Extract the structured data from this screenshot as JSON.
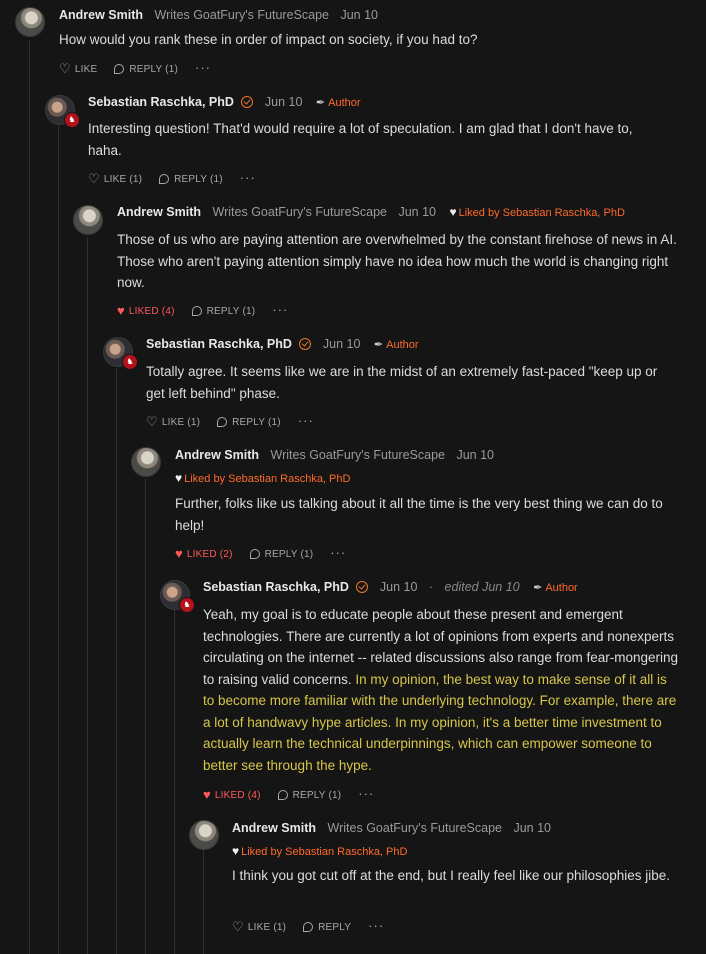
{
  "comments": [
    {
      "name": "Andrew Smith",
      "subtitle": "Writes GoatFury's FutureScape",
      "date": "Jun 10",
      "text": "How would you rank these in order of impact on society, if you had to?",
      "like": "LIKE",
      "reply": "REPLY (1)"
    },
    {
      "name": "Sebastian Raschka, PhD",
      "date": "Jun 10",
      "author_tag": "Author",
      "text": "Interesting question! That'd would require a lot of speculation. I am glad that I don't have to, haha.",
      "like": "LIKE (1)",
      "reply": "REPLY (1)"
    },
    {
      "name": "Andrew Smith",
      "subtitle": "Writes GoatFury's FutureScape",
      "date": "Jun 10",
      "liked_by": "Liked by Sebastian Raschka, PhD",
      "text": "Those of us who are paying attention are overwhelmed by the constant firehose of news in AI. Those who aren't paying attention simply have no idea how much the world is changing right now.",
      "like": "LIKED (4)",
      "reply": "REPLY (1)"
    },
    {
      "name": "Sebastian Raschka, PhD",
      "date": "Jun 10",
      "author_tag": "Author",
      "text": "Totally agree. It seems like we are in the midst of an extremely fast-paced \"keep up or get left behind\" phase.",
      "like": "LIKE (1)",
      "reply": "REPLY (1)"
    },
    {
      "name": "Andrew Smith",
      "subtitle": "Writes GoatFury's FutureScape",
      "date": "Jun 10",
      "liked_by": "Liked by Sebastian Raschka, PhD",
      "text": "Further, folks like us talking about it all the time is the very best thing we can do to help!",
      "like": "LIKED (2)",
      "reply": "REPLY (1)"
    },
    {
      "name": "Sebastian Raschka, PhD",
      "date": "Jun 10",
      "edited": "edited Jun 10",
      "author_tag": "Author",
      "text_plain": "Yeah, my goal is to educate people about these present and emergent technologies. There are currently a lot of opinions from experts and nonexperts circulating on the internet -- related discussions also range from fear-mongering to raising valid concerns.",
      "text_highlight": "In my opinion, the best way to make sense of it all is to become more familiar with the underlying technology. For example, there are a lot of handwavy hype articles. In my opinion, it's a better time investment to actually learn the technical underpinnings, which can empower someone to better see through the hype.",
      "like": "LIKED (4)",
      "reply": "REPLY (1)"
    },
    {
      "name": "Andrew Smith",
      "subtitle": "Writes GoatFury's FutureScape",
      "date": "Jun 10",
      "liked_by": "Liked by Sebastian Raschka, PhD",
      "text": "I think you got cut off at the end, but I really feel like our philosophies jibe.",
      "like": "LIKE (1)",
      "reply": "REPLY"
    }
  ],
  "colors": {
    "background": "#151515",
    "accent": "#ff6a2b",
    "liked": "#ff5a5a",
    "highlight": "#d7c64a"
  },
  "icons": [
    "heart-icon",
    "reply-icon",
    "more-icon",
    "verified-icon",
    "pen-icon"
  ]
}
